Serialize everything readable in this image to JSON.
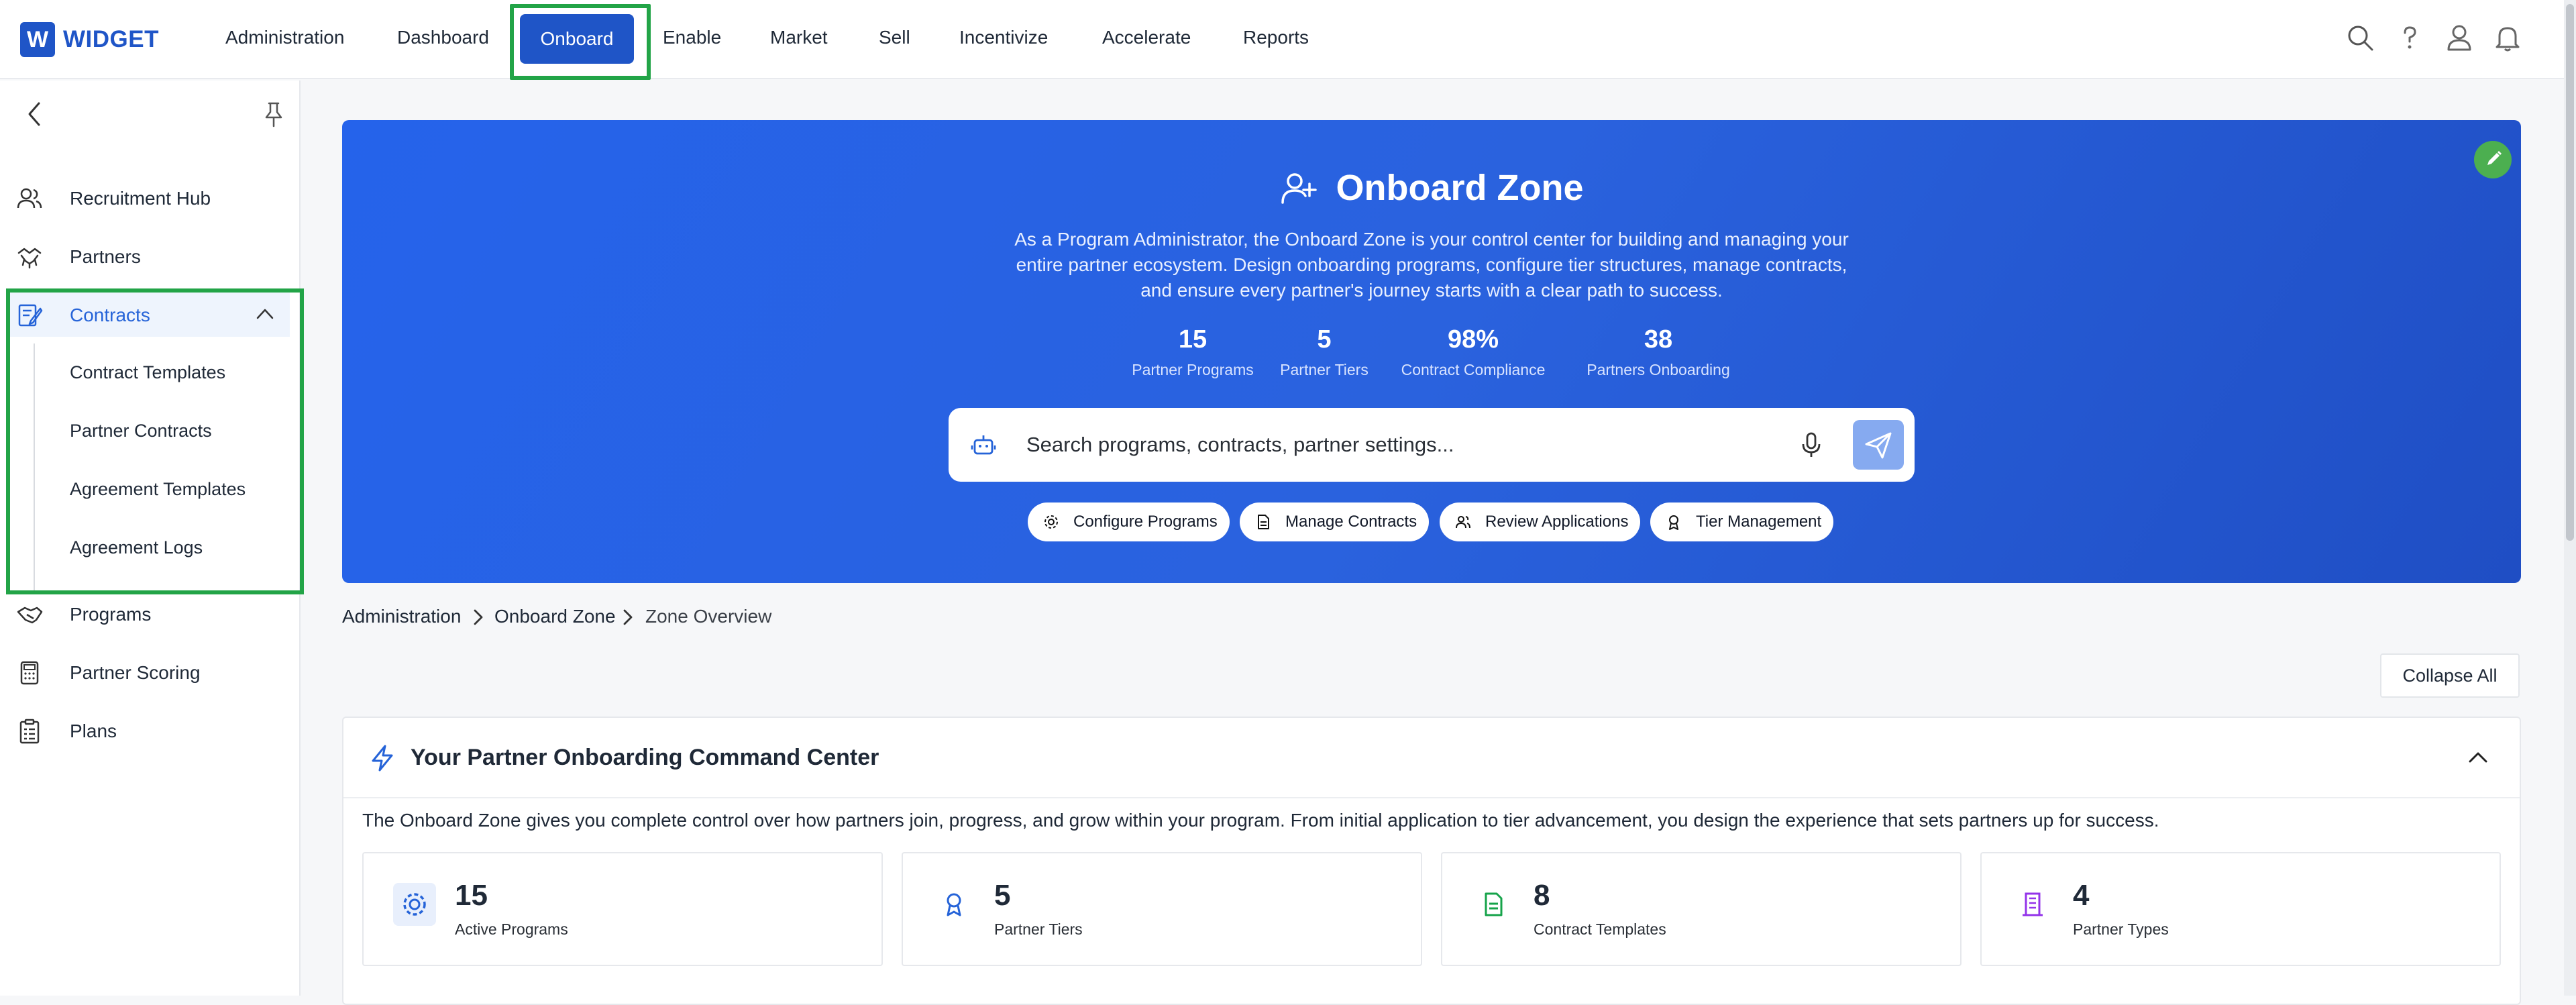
{
  "app": {
    "logo_letter": "W",
    "logo_text": "WIDGET"
  },
  "nav": {
    "items": [
      "Administration",
      "Dashboard",
      "Onboard",
      "Enable",
      "Market",
      "Sell",
      "Incentivize",
      "Accelerate",
      "Reports"
    ],
    "active": "Onboard"
  },
  "top_icons": [
    "search-icon",
    "help-icon",
    "user-icon",
    "bell-icon"
  ],
  "sidebar": {
    "items": [
      {
        "label": "Recruitment Hub",
        "icon": "users-icon"
      },
      {
        "label": "Partners",
        "icon": "handshake-icon"
      },
      {
        "label": "Contracts",
        "icon": "contract-icon",
        "expanded": true
      },
      {
        "label": "Programs",
        "icon": "programs-icon"
      },
      {
        "label": "Partner Scoring",
        "icon": "calculator-icon"
      },
      {
        "label": "Plans",
        "icon": "clipboard-icon"
      }
    ],
    "contracts_children": [
      "Contract Templates",
      "Partner Contracts",
      "Agreement Templates",
      "Agreement Logs"
    ]
  },
  "hero": {
    "title": "Onboard Zone",
    "description": "As a Program Administrator, the Onboard Zone is your control center for building and managing your entire partner ecosystem. Design onboarding programs, configure tier structures, manage contracts, and ensure every partner's journey starts with a clear path to success.",
    "stats": [
      {
        "value": "15",
        "label": "Partner Programs"
      },
      {
        "value": "5",
        "label": "Partner Tiers"
      },
      {
        "value": "98%",
        "label": "Contract Compliance"
      },
      {
        "value": "38",
        "label": "Partners Onboarding"
      }
    ],
    "search_placeholder": "Search programs, contracts, partner settings...",
    "chips": [
      {
        "label": "Configure Programs",
        "icon": "gear-icon"
      },
      {
        "label": "Manage Contracts",
        "icon": "document-icon"
      },
      {
        "label": "Review Applications",
        "icon": "users-icon"
      },
      {
        "label": "Tier Management",
        "icon": "award-icon"
      }
    ]
  },
  "breadcrumb": [
    "Administration",
    "Onboard Zone",
    "Zone Overview"
  ],
  "collapse_label": "Collapse All",
  "command_center": {
    "title": "Your Partner Onboarding Command Center",
    "description": "The Onboard Zone gives you complete control over how partners join, progress, and grow within your program. From initial application to tier advancement, you design the experience that sets partners up for success.",
    "metrics": [
      {
        "value": "15",
        "label": "Active Programs",
        "icon": "gear-icon",
        "color": "#2563d8"
      },
      {
        "value": "5",
        "label": "Partner Tiers",
        "icon": "award-icon",
        "color": "#2563d8"
      },
      {
        "value": "8",
        "label": "Contract Templates",
        "icon": "document-icon",
        "color": "#16a34a"
      },
      {
        "value": "4",
        "label": "Partner Types",
        "icon": "building-icon",
        "color": "#9333ea"
      }
    ]
  },
  "colors": {
    "brand": "#1f55c7",
    "hero_gradient_start": "#2563eb",
    "hero_gradient_end": "#1f4ec4",
    "highlight": "#22a447",
    "edit_badge": "#4caf50"
  }
}
